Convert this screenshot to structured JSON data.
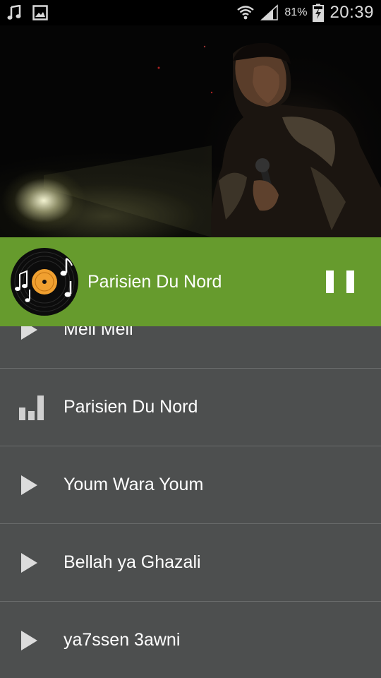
{
  "status_bar": {
    "left_icons": [
      "music-note-icon",
      "image-icon"
    ],
    "battery_percent": "81%",
    "clock": "20:39"
  },
  "now_playing": {
    "title": "Parisien Du Nord",
    "state": "playing",
    "accent_color": "#669b2d"
  },
  "tracks": [
    {
      "title": "Meli Meli",
      "icon": "play-icon"
    },
    {
      "title": "Parisien Du Nord",
      "icon": "equalizer-icon",
      "active": true
    },
    {
      "title": "Youm Wara Youm",
      "icon": "play-icon"
    },
    {
      "title": "Bellah ya Ghazali",
      "icon": "play-icon"
    },
    {
      "title": "ya7ssen 3awni",
      "icon": "play-icon"
    }
  ]
}
